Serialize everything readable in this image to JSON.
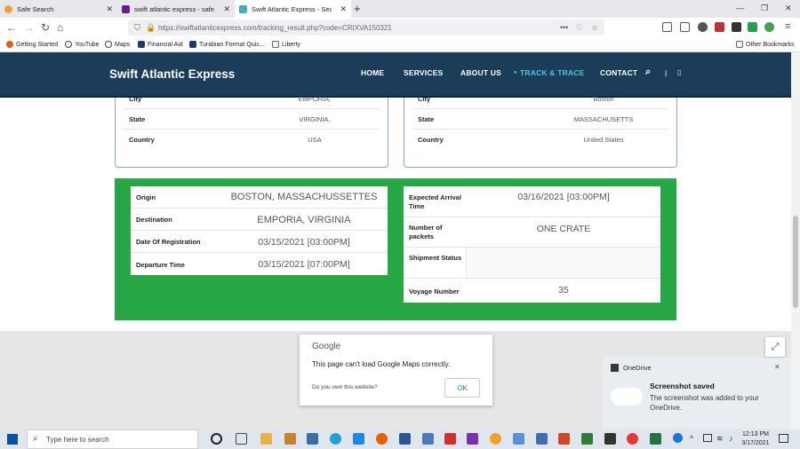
{
  "browser": {
    "tabs": [
      {
        "title": "Safe Search",
        "color": "#f0a030"
      },
      {
        "title": "swift atlantic express - safesear",
        "color": "#6a1b9a"
      },
      {
        "title": "Swift Atlantic Express - Secure",
        "color": "#3ab0c8"
      }
    ],
    "new_tab_glyph": "+",
    "url": "https://swiftatlanticexpress.com/tracking_result.php?code=CRIXVA150321",
    "bookmarks": [
      "Getting Started",
      "YouTube",
      "Maps",
      "Financial Aid",
      "Turabian Format Quic...",
      "Liberty"
    ],
    "other_bookmarks": "Other Bookmarks"
  },
  "site": {
    "logo": "Swift Atlantic Express",
    "menu": [
      "HOME",
      "SERVICES",
      "ABOUT US",
      "TRACK & TRACE",
      "CONTACT"
    ],
    "active_menu": "TRACK & TRACE",
    "accent": "#4ec3df",
    "header_bg": "#1c3d5a"
  },
  "sender": {
    "rows": [
      {
        "label": "City",
        "value": "EMPORIA,"
      },
      {
        "label": "State",
        "value": "VIRGINIA,"
      },
      {
        "label": "Country",
        "value": "USA"
      }
    ]
  },
  "receiver": {
    "rows": [
      {
        "label": "City",
        "value": "Boston"
      },
      {
        "label": "State",
        "value": "MASSACHUSETTS"
      },
      {
        "label": "Country",
        "value": "United States"
      }
    ]
  },
  "shipment": {
    "left": [
      {
        "label": "Origin",
        "value": "BOSTON, MASSACHUSSETTES"
      },
      {
        "label": "Destination",
        "value": "EMPORIA, VIRGINIA"
      },
      {
        "label": "Date Of Registration",
        "value": "03/15/2021 [03:00PM]"
      },
      {
        "label": "Departure Time",
        "value": "03/15/2021 [07:00PM]"
      }
    ],
    "right": [
      {
        "label": "Expected Arrival Time",
        "value": "03/16/2021 [03:00PM]"
      },
      {
        "label": "Number of packets",
        "value": "ONE CRATE"
      },
      {
        "label": "Shipment Status",
        "value": ""
      },
      {
        "label": "Voyage Number",
        "value": "35"
      }
    ],
    "panel_color": "#28a745"
  },
  "map_dialog": {
    "brand": "Google",
    "message": "This page can't load Google Maps correctly.",
    "question": "Do you own this website?",
    "ok": "OK"
  },
  "toast": {
    "app": "OneDrive",
    "title": "Screenshot saved",
    "body": "The screenshot was added to your OneDrive."
  },
  "taskbar": {
    "search_placeholder": "Type here to search",
    "time": "12:13 PM",
    "date": "3/17/2021"
  }
}
